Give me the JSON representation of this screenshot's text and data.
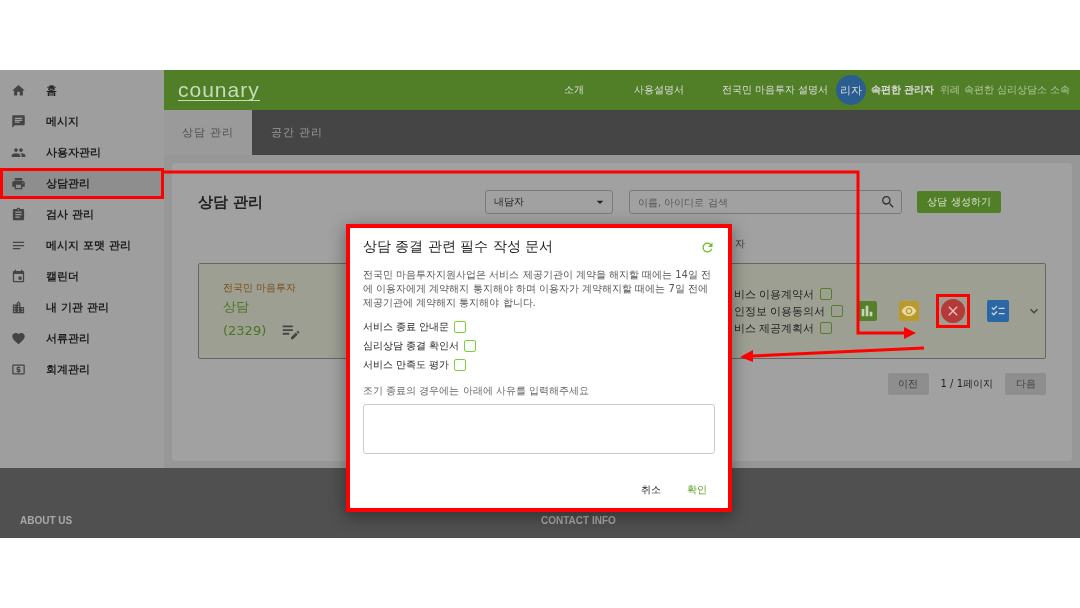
{
  "sidebar": {
    "items": [
      {
        "label": "홈",
        "selected": false
      },
      {
        "label": "메시지",
        "selected": false
      },
      {
        "label": "사용자관리",
        "selected": false
      },
      {
        "label": "상담관리",
        "selected": true
      },
      {
        "label": "검사 관리",
        "selected": false
      },
      {
        "label": "메시지 포맷 관리",
        "selected": false
      },
      {
        "label": "캘린더",
        "selected": false
      },
      {
        "label": "내 기관 관리",
        "selected": false
      },
      {
        "label": "서류관리",
        "selected": false
      },
      {
        "label": "회계관리",
        "selected": false
      }
    ]
  },
  "header": {
    "logo": "counary",
    "nav": [
      "소개",
      "사용설명서",
      "전국민 마음투자 설명서"
    ],
    "user": {
      "avatar": "리자",
      "name": "속편한 관리자",
      "org": "위례 속편한 심리상담소 소속"
    }
  },
  "tabs": [
    {
      "label": "상담 관리",
      "selected": true
    },
    {
      "label": "공간 관리",
      "selected": false
    }
  ],
  "page": {
    "title": "상담 관리",
    "filter": "내담자",
    "search": {
      "placeholder": "이름, 아이디로 검색"
    },
    "create_button": "상담 생성하기",
    "partial_text": "자"
  },
  "card": {
    "program": "전국민 마음투자",
    "title": "상담",
    "count": "(2329)",
    "documents": [
      {
        "label": "비스 이용계약서",
        "checked": false
      },
      {
        "label": "인정보 이용동의서",
        "checked": false
      },
      {
        "label": "비스 제공계획서",
        "checked": false
      }
    ],
    "actions": [
      {
        "kind": "chart",
        "annotated": false
      },
      {
        "kind": "view",
        "annotated": false
      },
      {
        "kind": "cancel",
        "annotated": true
      },
      {
        "kind": "checklist",
        "annotated": false
      }
    ]
  },
  "pagination": {
    "prev": "이전",
    "status": "1 / 1페이지",
    "next": "다음"
  },
  "dialog": {
    "title": "상담 종결 관련 필수 작성 문서",
    "notice": "전국민 마음투자지원사업은 서비스 제공기관이 계약을 해지할 때에는 14일 전에 이용자에게 계약해지 통지해야 하며 이용자가 계약해지할 때에는 7일 전에 제공기관에 계약해지 통지해야 합니다.",
    "documents": [
      {
        "label": "서비스 종료 안내문",
        "checked": false
      },
      {
        "label": "심리상담 종결 확인서",
        "checked": false
      },
      {
        "label": "서비스 만족도 평가",
        "checked": false
      }
    ],
    "reason": {
      "label": "조기 종료의 경우에는 아래에 사유를 입력해주세요"
    },
    "buttons": [
      {
        "label": "취소",
        "kind": "cancel"
      },
      {
        "label": "확인",
        "kind": "confirm"
      }
    ]
  },
  "footer": {
    "sections": [
      "ABOUT US",
      "CONTACT INFO"
    ]
  }
}
